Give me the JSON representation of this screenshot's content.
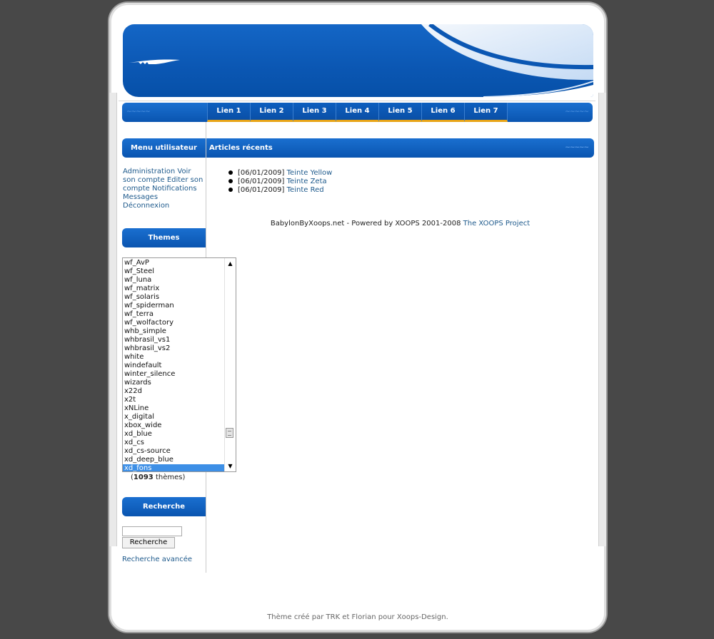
{
  "nav": {
    "items": [
      "Lien 1",
      "Lien 2",
      "Lien 3",
      "Lien 4",
      "Lien 5",
      "Lien 6",
      "Lien 7"
    ]
  },
  "user_menu": {
    "title": "Menu utilisateur",
    "links": [
      "Administration",
      "Voir son compte",
      "Editer son compte",
      "Notifications",
      "Messages",
      "Déconnexion"
    ]
  },
  "articles": {
    "title": "Articles récents",
    "items": [
      {
        "date": "[06/01/2009]",
        "title": "Teinte Yellow"
      },
      {
        "date": "[06/01/2009]",
        "title": "Teinte Zeta"
      },
      {
        "date": "[06/01/2009]",
        "title": "Teinte Red"
      }
    ]
  },
  "footer": {
    "powered_text": "BabylonByXoops.net - Powered by XOOPS 2001-2008",
    "project_link": "The XOOPS Project",
    "credits": "Thème créé par TRK et Florian pour Xoops-Design."
  },
  "themes": {
    "title": "Themes",
    "options": [
      "wf_AvP",
      "wf_Steel",
      "wf_luna",
      "wf_matrix",
      "wf_solaris",
      "wf_spiderman",
      "wf_terra",
      "wf_wolfactory",
      "whb_simple",
      "whbrasil_vs1",
      "whbrasil_vs2",
      "white",
      "windefault",
      "winter_silence",
      "wizards",
      "x22d",
      "x2t",
      "xNLine",
      "x_digital",
      "xbox_wide",
      "xd_blue",
      "xd_cs",
      "xd_cs-source",
      "xd_deep_blue",
      "xd_fons"
    ],
    "selected": "xd_fons",
    "count": "1093",
    "count_suffix": "thèmes"
  },
  "search": {
    "title": "Recherche",
    "button": "Recherche",
    "advanced": "Recherche avancée",
    "value": ""
  },
  "colors": {
    "primary_blue": "#0a55b0",
    "accent_orange": "#e8a417",
    "link": "#1e5a8c",
    "background": "#484848"
  }
}
